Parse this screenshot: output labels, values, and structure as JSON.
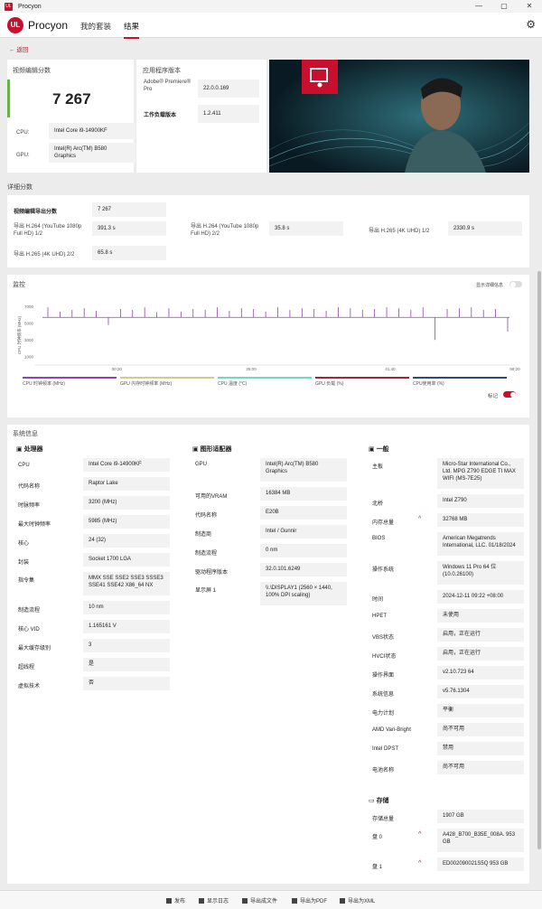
{
  "window": {
    "title": "Procyon",
    "controls": [
      "—",
      "▢",
      "✕"
    ]
  },
  "appbar": {
    "logo": "UL",
    "app_name": "Procyon",
    "nav": [
      "我的套装",
      "结果"
    ],
    "settings_icon": "gear-icon"
  },
  "back_label": "返回",
  "score_card": {
    "title": "视频编辑分数",
    "score": "7 267",
    "cpu_label": "CPU:",
    "cpu_value": "Intel Core i9-14900KF",
    "gpu_label": "GPU:",
    "gpu_value": "Intel(R) Arc(TM) B580 Graphics"
  },
  "app_version": {
    "title": "应用程序版本",
    "app_label": "Adobe® Premiere® Pro",
    "app_value": "22.0.0.169",
    "workload_label": "工作负载版本",
    "workload_value": "1.2.411"
  },
  "detail_scores": {
    "title": "详细分数",
    "main_label": "视频编辑导出分数",
    "main_value": "7 267",
    "items": [
      {
        "label": "导出 H.264 (YouTube 1080p Full HD) 1/2",
        "value": "391.3 s"
      },
      {
        "label": "导出 H.264 (YouTube 1080p Full HD) 2/2",
        "value": "35.8 s"
      },
      {
        "label": "导出 H.265 (4K UHD) 1/2",
        "value": "2330.9 s"
      },
      {
        "label": "导出 H.265 (4K UHD) 2/2",
        "value": "65.8 s"
      }
    ]
  },
  "monitor": {
    "title": "监控",
    "show_details": "显示详细信息",
    "markers_label": "标记",
    "y_axis_label": "CPU 时钟频率 (MHz)",
    "y_ticks": [
      "7000",
      "5000",
      "3000",
      "1000"
    ],
    "x_ticks": [
      "00:20",
      "25:00",
      "41:40",
      "58:20"
    ],
    "legend": [
      {
        "label": "CPU 时钟频率 (MHz)",
        "color": "#8e44ad"
      },
      {
        "label": "GPU 内存时钟频率 (MHz)",
        "color": "#d7c98d"
      },
      {
        "label": "CPU 温度 (°C)",
        "color": "#6fd8c5"
      },
      {
        "label": "GPU 负载 (%)",
        "color": "#a3243b"
      },
      {
        "label": "CPU使用率 (%)",
        "color": "#2b4a7c"
      }
    ],
    "accent": "#c8102e"
  },
  "chart_data": {
    "type": "line",
    "ylabel": "CPU 时钟频率 (MHz)",
    "x_ticks": [
      "00:20",
      "25:00",
      "41:40",
      "58:20"
    ],
    "series": [
      {
        "name": "CPU 时钟频率 (MHz)",
        "baseline": 5700,
        "spikes": [
          6900,
          6400,
          6600,
          6800,
          6500,
          4800,
          6700,
          6600,
          6900,
          6300,
          6800,
          6400,
          6700,
          6600,
          6900,
          6500,
          6800,
          6700,
          6400,
          6900,
          6600,
          6800,
          6700,
          6500,
          6900,
          6800,
          6600,
          6700,
          6900,
          6800,
          6600,
          6900,
          3000,
          6700,
          6800,
          6900,
          6600,
          6700,
          4000
        ]
      }
    ],
    "ylim": [
      0,
      8000
    ]
  },
  "sysinfo": {
    "title": "系统信息",
    "cpu": {
      "heading": "处理器",
      "rows": [
        [
          "CPU",
          "Intel Core i9-14900KF"
        ],
        [
          "代码名称",
          "Raptor Lake"
        ],
        [
          "时脉频率",
          "3200 (MHz)"
        ],
        [
          "最大时钟频率",
          "5985 (MHz)"
        ],
        [
          "核心",
          "24 (32)"
        ],
        [
          "封装",
          "Socket 1700 LGA"
        ],
        [
          "指令集",
          "MMX SSE SSE2 SSE3 SSSE3 SSE41 SSE42 X86_64 NX"
        ],
        [
          "制造流程",
          "10 nm"
        ],
        [
          "核心 VID",
          "1.165161 V"
        ],
        [
          "最大缓存级别",
          "3"
        ],
        [
          "超线程",
          "是"
        ],
        [
          "虚拟技术",
          "否"
        ]
      ]
    },
    "gpu": {
      "heading": "图形适配器",
      "rows": [
        [
          "GPU",
          "Intel(R) Arc(TM) B580 Graphics"
        ],
        [
          "可用的VRAM",
          "16384 MB"
        ],
        [
          "代码名称",
          "E20B"
        ],
        [
          "制造商",
          "Intel / Gunnir"
        ],
        [
          "制造流程",
          "0 nm"
        ],
        [
          "驱动程序版本",
          "32.0.101.6249"
        ],
        [
          "显示屏 1",
          "\\\\.\\DISPLAY1 (2560 × 1440, 100% DPI scaling)"
        ]
      ]
    },
    "general": {
      "heading": "一般",
      "rows": [
        [
          "主板",
          "Micro-Star International Co., Ltd. MPG Z790 EDGE TI MAX WIFI (MS-7E25)",
          false
        ],
        [
          "北桥",
          "Intel Z790",
          false
        ],
        [
          "内存总量",
          "32768 MB",
          true
        ],
        [
          "BIOS",
          "American Megatrends International, LLC. 01/18/2024",
          false
        ],
        [
          "操作系统",
          "Windows 11 Pro 64 位 (10.0.26100)",
          false
        ],
        [
          "时间",
          "2024-12-11 09:22 +08:00",
          false
        ],
        [
          "HPET",
          "未使用",
          false
        ],
        [
          "VBS状态",
          "启用，正在运行",
          false
        ],
        [
          "HVCI状态",
          "启用，正在运行",
          false
        ],
        [
          "操作界面",
          "v2.10.723 64",
          false
        ],
        [
          "系统信息",
          "v5.76.1304",
          false
        ],
        [
          "电力计划",
          "平衡",
          false
        ],
        [
          "AMD Vari-Bright",
          "尚不可用",
          false
        ],
        [
          "Intel DPST",
          "禁用",
          false
        ],
        [
          "电池名称",
          "尚不可用",
          false
        ]
      ]
    },
    "storage": {
      "heading": "存储",
      "rows": [
        [
          "存储总量",
          "1907 GB",
          false
        ],
        [
          "盘 0",
          "A428_B700_B35E_008A. 953 GB",
          true
        ],
        [
          "盘 1",
          "ED002090021S5Q 953 GB",
          true
        ]
      ]
    }
  },
  "bottom_actions": [
    "发布",
    "显示日志",
    "导出成文件",
    "导出为PDF",
    "导出为XML"
  ]
}
